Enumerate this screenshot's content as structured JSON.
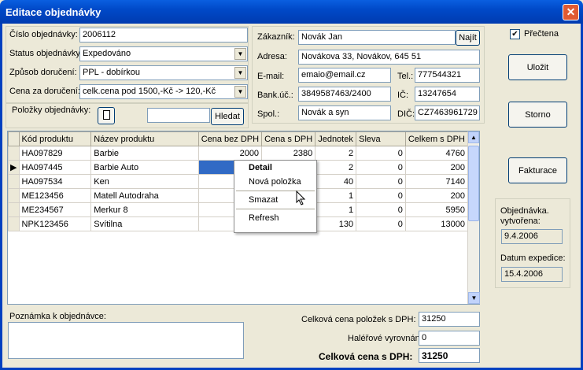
{
  "window": {
    "title": "Editace objednávky"
  },
  "order": {
    "number_label": "Číslo objednávky:",
    "number_value": "2006112",
    "status_label": "Status objednávky:",
    "status_value": "Expedováno",
    "delivery_label": "Způsob doručení:",
    "delivery_value": "PPL - dobírkou",
    "price_label": "Cena za doručení:",
    "price_value": "celk.cena pod 1500,-Kč -> 120,-Kč",
    "items_label": "Položky objednávky:",
    "search_button": "Hledat",
    "search_value": ""
  },
  "customer": {
    "name_label": "Zákazník:",
    "name_value": "Novák Jan",
    "find_button": "Najít",
    "address_label": "Adresa:",
    "address_value": "Novákova 33, Novákov, 645 51",
    "email_label": "E-mail:",
    "email_value": "emaio@email.cz",
    "phone_label": "Tel.:",
    "phone_value": "777544321",
    "bank_label": "Bank.úč.:",
    "bank_value": "3849587463/2400",
    "ic_label": "IČ:",
    "ic_value": "13247654",
    "company_label": "Spol.:",
    "company_value": "Novák a syn",
    "dic_label": "DIČ:",
    "dic_value": "CZ7463961729"
  },
  "checkbox": {
    "label": "Přečtena",
    "checked": true
  },
  "buttons": {
    "save": "Uložit",
    "cancel": "Storno",
    "invoice": "Fakturace"
  },
  "info": {
    "created_label": "Objednávka. vytvořena:",
    "created_value": "9.4.2006",
    "shipped_label": "Datum expedice:",
    "shipped_value": "15.4.2006"
  },
  "grid": {
    "columns": [
      "Kód produktu",
      "Název produktu",
      "Cena bez DPH",
      "Cena s DPH",
      "Jednotek",
      "Sleva",
      "Celkem s DPH"
    ],
    "rows": [
      [
        "HA097829",
        "Barbie",
        "2000",
        "2380",
        "2",
        "0",
        "4760"
      ],
      [
        "HA097445",
        "Barbie Auto",
        "",
        "",
        "2",
        "0",
        "200"
      ],
      [
        "HA097534",
        "Ken",
        "",
        "",
        "40",
        "0",
        "7140"
      ],
      [
        "ME123456",
        "Matell Autodraha",
        "",
        "",
        "1",
        "0",
        "200"
      ],
      [
        "ME234567",
        "Merkur 8",
        "",
        "",
        "1",
        "0",
        "5950"
      ],
      [
        "NPK123456",
        "Svítilna",
        "",
        "",
        "130",
        "0",
        "13000"
      ]
    ]
  },
  "context_menu": {
    "detail": "Detail",
    "new_item": "Nová položka",
    "delete": "Smazat",
    "refresh": "Refresh"
  },
  "note": {
    "label": "Poznámka k objednávce:",
    "value": ""
  },
  "totals": {
    "items_label": "Celková cena položek s DPH:",
    "items_value": "31250",
    "rounding_label": "Haléřové vyrovnání:",
    "rounding_value": "0",
    "total_label": "Celková cena s DPH:",
    "total_value": "31250"
  }
}
